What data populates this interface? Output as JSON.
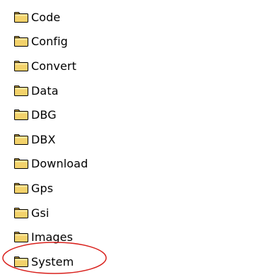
{
  "folders": [
    {
      "label": "Code"
    },
    {
      "label": "Config"
    },
    {
      "label": "Convert"
    },
    {
      "label": "Data"
    },
    {
      "label": "DBG"
    },
    {
      "label": "DBX"
    },
    {
      "label": "Download"
    },
    {
      "label": "Gps"
    },
    {
      "label": "Gsi"
    },
    {
      "label": "Images"
    },
    {
      "label": "System"
    }
  ],
  "icon": "folder-icon",
  "highlight": {
    "target": "System",
    "color": "#d9211d"
  },
  "colors": {
    "folder_fill": "#f3d26b",
    "folder_tab": "#e9be4c",
    "folder_outline": "#000000"
  }
}
